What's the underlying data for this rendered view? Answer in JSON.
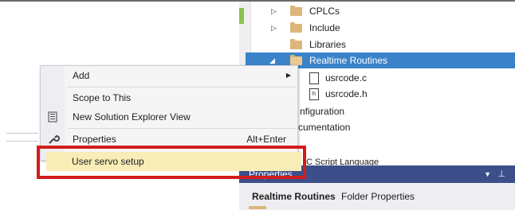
{
  "tree": {
    "items": [
      {
        "label": "CPLCs",
        "type": "folder",
        "expandable": true
      },
      {
        "label": "Include",
        "type": "folder",
        "expandable": true
      },
      {
        "label": "Libraries",
        "type": "folder",
        "expandable": false
      },
      {
        "label": "Realtime Routines",
        "type": "folder",
        "expanded": true,
        "selected": true
      },
      {
        "label": "usrcode.c",
        "type": "file-c"
      },
      {
        "label": "usrcode.h",
        "type": "file-h"
      },
      {
        "label": "nfiguration"
      },
      {
        "label": "cumentation"
      },
      {
        "label": "C Script Language"
      }
    ]
  },
  "context_menu": {
    "items": [
      {
        "label": "Add",
        "has_submenu": true
      },
      {
        "label": "Scope to This"
      },
      {
        "label": "New Solution Explorer View",
        "icon": "new-view-icon"
      },
      {
        "label": "Properties",
        "shortcut": "Alt+Enter",
        "icon": "wrench-icon"
      }
    ],
    "highlighted_item": "User servo setup"
  },
  "properties_panel": {
    "title": "Properties",
    "object_name": "Realtime Routines",
    "object_type": "Folder Properties"
  },
  "colors": {
    "selection": "#3a83c9",
    "panel_title": "#3c4f8a",
    "highlight_border": "#d41c1c",
    "hover": "#fdf3bf"
  }
}
